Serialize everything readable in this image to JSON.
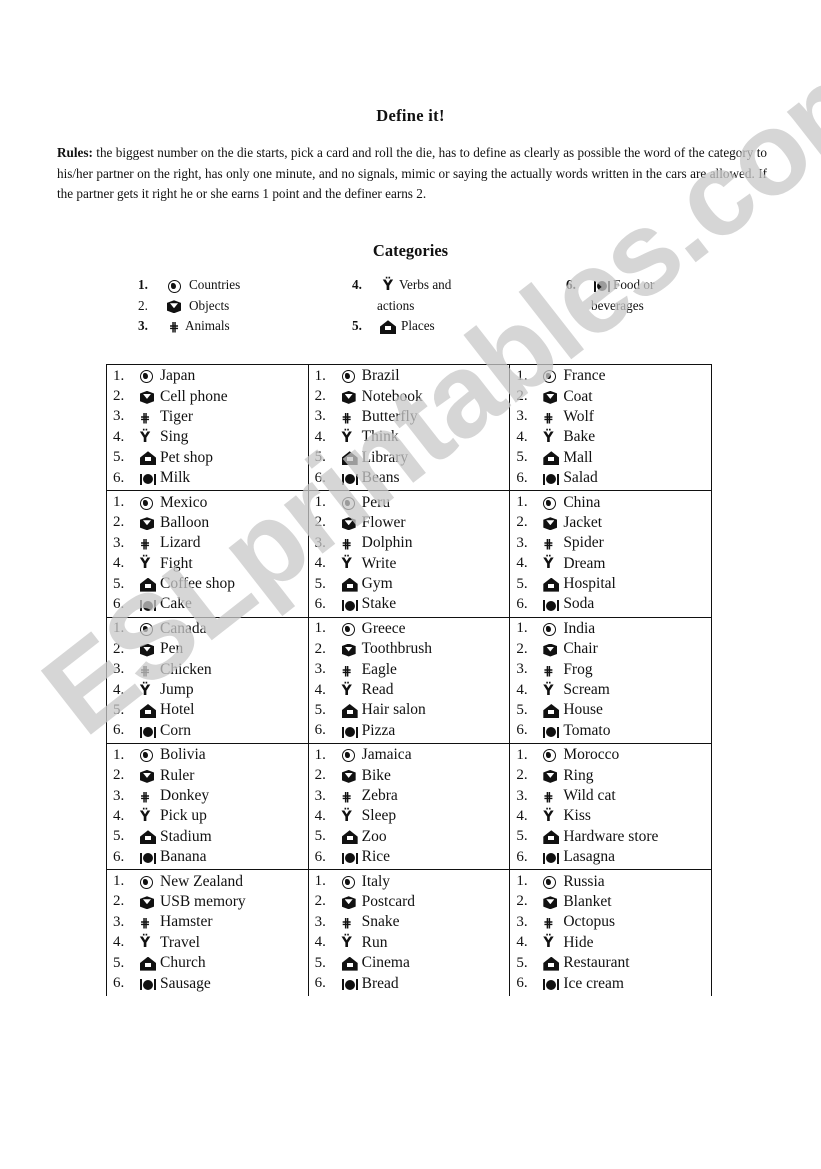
{
  "document": {
    "title": "Define it!",
    "rules_label": "Rules:",
    "rules_text": " the biggest number on the die starts, pick a card and roll the die, has to define as clearly as possible the word of the category to his/her partner on the right, has only one minute, and no signals, mimic or saying the actually words written in the cars are allowed. If the partner gets it right he or she earns 1 point and the definer earns 2.",
    "categories_title": "Categories",
    "watermark": "ESLprintables.com"
  },
  "categories": [
    {
      "num": "1.",
      "icon": "globe-icon",
      "label": "Countries"
    },
    {
      "num": "2.",
      "icon": "box-icon",
      "label": "Objects"
    },
    {
      "num": "3.",
      "icon": "bug-icon",
      "label": "Animals"
    },
    {
      "num": "4.",
      "icon": "weightlifter-icon",
      "label": "Verbs and",
      "label_cont": "actions"
    },
    {
      "num": "5.",
      "icon": "house-icon",
      "label": "Places"
    },
    {
      "num": "6.",
      "icon": "food-icon",
      "label": "Food or",
      "label_cont": "beverages"
    }
  ],
  "item_numbers": [
    "1.",
    "2.",
    "3.",
    "4.",
    "5.",
    "6."
  ],
  "cards": [
    [
      [
        "Japan",
        "Cell phone",
        "Tiger",
        "Sing",
        "Pet shop",
        "Milk"
      ],
      [
        "Brazil",
        "Notebook",
        "Butterfly",
        "Think",
        "Library",
        "Beans"
      ],
      [
        "France",
        "Coat",
        "Wolf",
        "Bake",
        "Mall",
        "Salad"
      ]
    ],
    [
      [
        "Mexico",
        "Balloon",
        "Lizard",
        "Fight",
        "Coffee shop",
        "Cake"
      ],
      [
        "Peru",
        "Flower",
        "Dolphin",
        "Write",
        "Gym",
        "Stake"
      ],
      [
        "China",
        "Jacket",
        "Spider",
        "Dream",
        "Hospital",
        "Soda"
      ]
    ],
    [
      [
        "Canada",
        "Pen",
        "Chicken",
        "Jump",
        "Hotel",
        "Corn"
      ],
      [
        "Greece",
        "Toothbrush",
        "Eagle",
        "Read",
        "Hair salon",
        "Pizza"
      ],
      [
        "India",
        "Chair",
        "Frog",
        "Scream",
        "House",
        "Tomato"
      ]
    ],
    [
      [
        "Bolivia",
        "Ruler",
        "Donkey",
        "Pick up",
        "Stadium",
        "Banana"
      ],
      [
        "Jamaica",
        "Bike",
        "Zebra",
        "Sleep",
        "Zoo",
        "Rice"
      ],
      [
        "Morocco",
        "Ring",
        "Wild cat",
        "Kiss",
        "Hardware store",
        "Lasagna"
      ]
    ],
    [
      [
        "New Zealand",
        "USB memory",
        "Hamster",
        "Travel",
        "Church",
        "Sausage"
      ],
      [
        "Italy",
        "Postcard",
        "Snake",
        "Run",
        "Cinema",
        "Bread"
      ],
      [
        "Russia",
        "Blanket",
        "Octopus",
        "Hide",
        "Restaurant",
        "Ice cream"
      ]
    ]
  ]
}
